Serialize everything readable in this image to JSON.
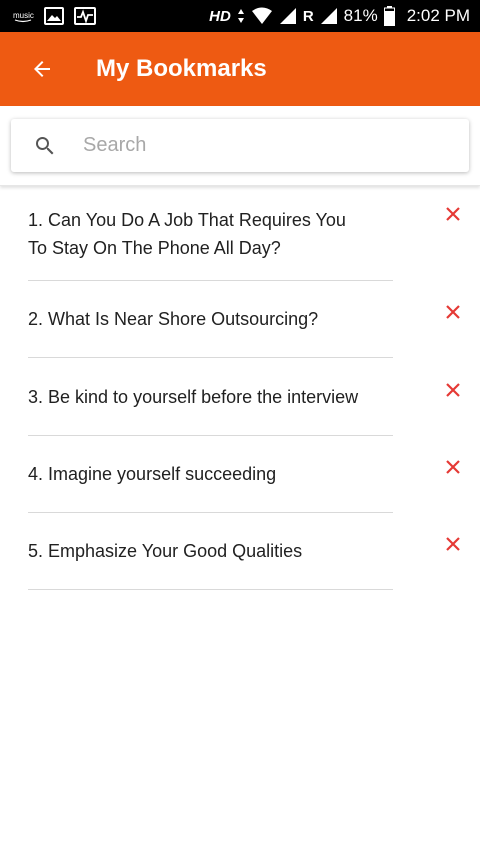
{
  "status_bar": {
    "left_icons": [
      "music-icon",
      "image-icon",
      "activity-icon"
    ],
    "hd": "HD",
    "roaming": "R",
    "battery": "81%",
    "time": "2:02 PM"
  },
  "app_bar": {
    "back_icon": "arrow-left-icon",
    "title": "My Bookmarks",
    "color": "#ee5a12"
  },
  "search": {
    "icon": "search-icon",
    "placeholder": "Search",
    "value": ""
  },
  "bookmarks": {
    "items": [
      {
        "label": "1. Can You Do A Job That Requires You To Stay On The Phone All Day?"
      },
      {
        "label": "2. What Is Near Shore Outsourcing?"
      },
      {
        "label": "3. Be kind to yourself before the interview"
      },
      {
        "label": "4. Imagine yourself succeeding"
      },
      {
        "label": "5. Emphasize Your Good Qualities"
      }
    ],
    "remove_icon": "close-icon",
    "remove_color": "#e53935"
  }
}
